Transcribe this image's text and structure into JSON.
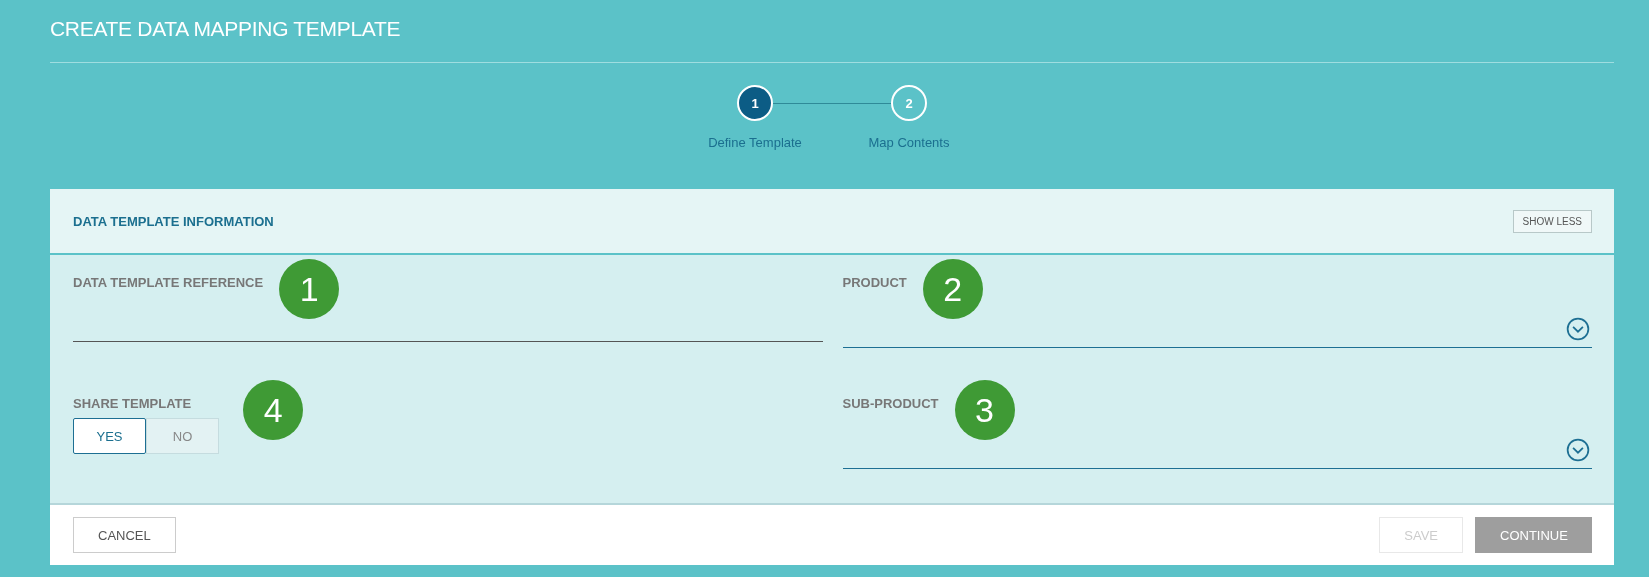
{
  "window": {
    "title": "CREATE DATA MAPPING TEMPLATE"
  },
  "steps": [
    {
      "number": "1",
      "label": "Define Template",
      "selected": true
    },
    {
      "number": "2",
      "label": "Map Contents",
      "selected": false
    }
  ],
  "section": {
    "title": "DATA TEMPLATE INFORMATION",
    "toggle_button": "SHOW LESS"
  },
  "fields": [
    {
      "kind": "text",
      "label": "DATA TEMPLATE REFERENCE",
      "marker": "1"
    },
    {
      "kind": "dropdown",
      "label": "PRODUCT",
      "marker": "2"
    },
    {
      "kind": "toggle",
      "label": "SHARE TEMPLATE",
      "marker": "4",
      "options": [
        {
          "label": "YES",
          "selected": true
        },
        {
          "label": "NO",
          "selected": false
        }
      ]
    },
    {
      "kind": "dropdown",
      "label": "SUB-PRODUCT",
      "marker": "3"
    }
  ],
  "footer": {
    "left_buttons": [
      {
        "label": "CANCEL",
        "disabled": false,
        "primary": false
      }
    ],
    "right_buttons": [
      {
        "label": "SAVE",
        "disabled": true,
        "primary": false
      },
      {
        "label": "CONTINUE",
        "disabled": true,
        "primary": true
      }
    ]
  }
}
